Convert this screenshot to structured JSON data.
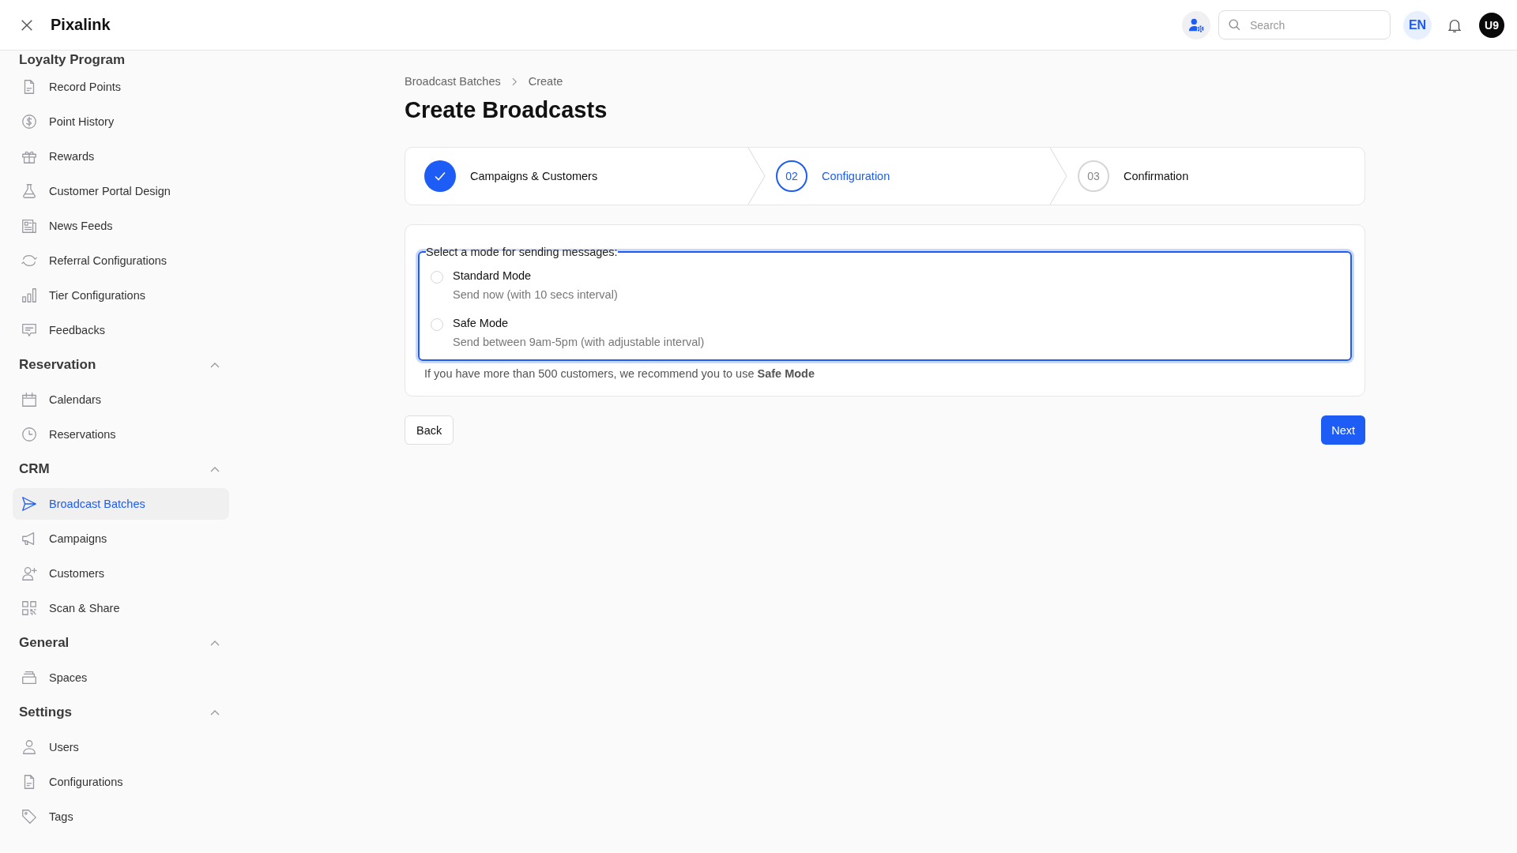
{
  "header": {
    "title": "Pixalink",
    "search": {
      "placeholder": "Search"
    },
    "language": "EN",
    "avatar": "U9"
  },
  "sidebar": {
    "groups": [
      {
        "title": "Loyalty Program",
        "items": [
          {
            "label": "Record Points",
            "selected": false
          },
          {
            "label": "Point History",
            "selected": false
          },
          {
            "label": "Rewards",
            "selected": false
          },
          {
            "label": "Customer Portal Design",
            "selected": false
          },
          {
            "label": "News Feeds",
            "selected": false
          },
          {
            "label": "Referral Configurations",
            "selected": false
          },
          {
            "label": "Tier Configurations",
            "selected": false
          },
          {
            "label": "Feedbacks",
            "selected": false
          }
        ]
      },
      {
        "title": "Reservation",
        "expanded": true,
        "items": [
          {
            "label": "Calendars",
            "selected": false
          },
          {
            "label": "Reservations",
            "selected": false
          }
        ]
      },
      {
        "title": "CRM",
        "expanded": true,
        "items": [
          {
            "label": "Broadcast Batches",
            "selected": true
          },
          {
            "label": "Campaigns",
            "selected": false
          },
          {
            "label": "Customers",
            "selected": false
          },
          {
            "label": "Scan & Share",
            "selected": false
          }
        ]
      },
      {
        "title": "General",
        "expanded": true,
        "items": [
          {
            "label": "Spaces",
            "selected": false
          }
        ]
      },
      {
        "title": "Settings",
        "expanded": true,
        "items": [
          {
            "label": "Users",
            "selected": false
          },
          {
            "label": "Configurations",
            "selected": false
          },
          {
            "label": "Tags",
            "selected": false
          }
        ]
      }
    ]
  },
  "breadcrumb": [
    "Broadcast Batches",
    "Create"
  ],
  "page_title": "Create Broadcasts",
  "steps": [
    {
      "kind": "done",
      "label": "Campaigns & Customers"
    },
    {
      "kind": "current",
      "number": "02",
      "label": "Configuration"
    },
    {
      "kind": "upcoming",
      "number": "03",
      "label": "Confirmation"
    }
  ],
  "form": {
    "legend": "Select a mode for sending messages:",
    "focused": true,
    "options": [
      {
        "title": "Standard Mode",
        "description": "Send now (with 10 secs interval)",
        "selected": false
      },
      {
        "title": "Safe Mode",
        "description": "Send between 9am-5pm (with adjustable interval)",
        "selected": false
      }
    ],
    "hint": "If you have more than 500 customers, we recommend you to use **Safe Mode**"
  },
  "buttons": {
    "back": "Back",
    "next": "Next"
  }
}
